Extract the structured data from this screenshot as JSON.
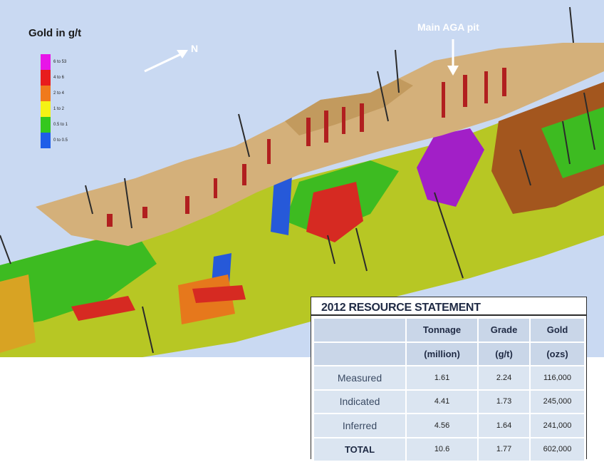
{
  "figure": {
    "legend_title": "Gold in g/t",
    "legend": [
      {
        "label": "6 to 53",
        "color": "#e815e8"
      },
      {
        "label": "4 to 6",
        "color": "#e81d1d"
      },
      {
        "label": "2 to 4",
        "color": "#f07a1c"
      },
      {
        "label": "1 to 2",
        "color": "#f5f215"
      },
      {
        "label": "0.5 to 1",
        "color": "#34c81e"
      },
      {
        "label": "0 to 0.5",
        "color": "#1f5ee8"
      }
    ],
    "north_label": "N",
    "pit_label": "Main AGA pit"
  },
  "resource": {
    "title": "2012 RESOURCE STATEMENT",
    "headers": [
      [
        "",
        "Tonnage",
        "Grade",
        "Gold"
      ],
      [
        "",
        "(million)",
        "(g/t)",
        "(ozs)"
      ]
    ],
    "rows": [
      [
        "Measured",
        "1.61",
        "2.24",
        "116,000"
      ],
      [
        "Indicated",
        "4.41",
        "1.73",
        "245,000"
      ],
      [
        "Inferred",
        "4.56",
        "1.64",
        "241,000"
      ],
      [
        "TOTAL",
        "10.6",
        "1.77",
        "602,000"
      ]
    ]
  }
}
